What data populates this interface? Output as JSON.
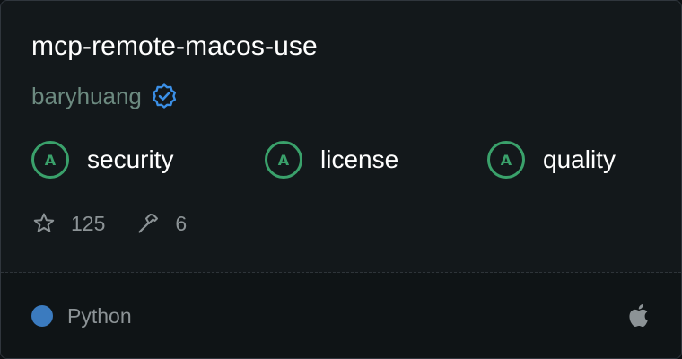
{
  "card": {
    "title": "mcp-remote-macos-use",
    "author": "baryhuang",
    "verified_icon": "verified-badge-icon",
    "grades": [
      {
        "grade": "A",
        "label": "security"
      },
      {
        "grade": "A",
        "label": "license"
      },
      {
        "grade": "A",
        "label": "quality"
      }
    ],
    "stats": {
      "stars": "125",
      "tools": "6",
      "stars_icon": "star-icon",
      "tools_icon": "hammer-icon"
    },
    "footer": {
      "language": "Python",
      "language_color": "#3b7bbf",
      "platform_icon": "apple-icon"
    }
  },
  "colors": {
    "grade_accent": "#3aa16b",
    "verified_accent": "#3b8fe6",
    "background": "#13181b"
  }
}
